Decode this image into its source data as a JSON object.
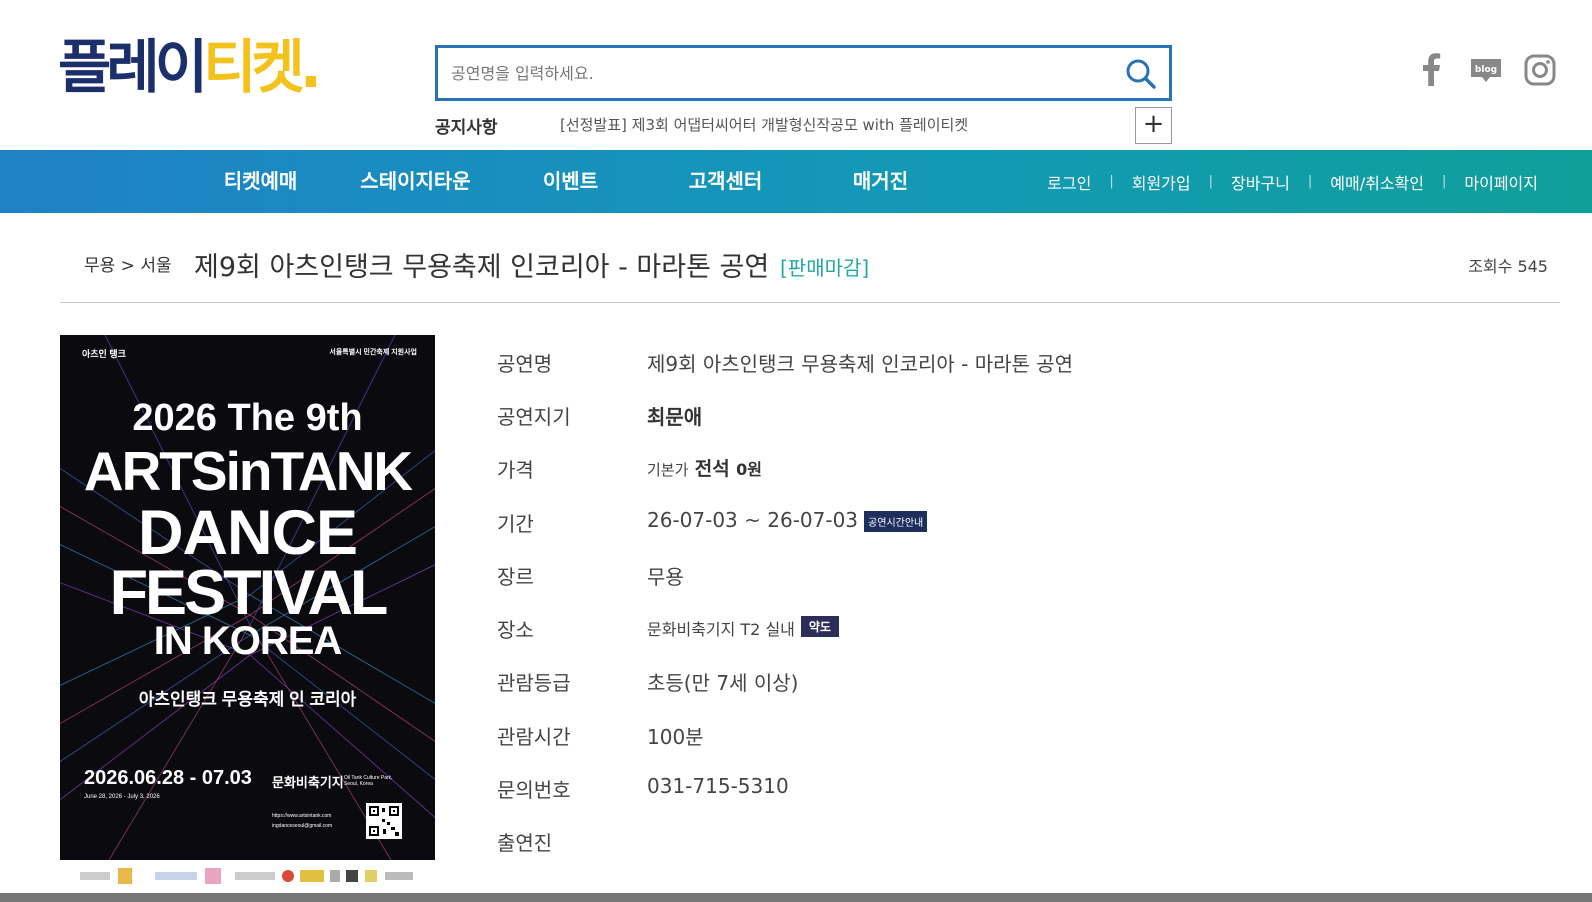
{
  "header": {
    "logo_part1": "플레이",
    "logo_part2": "티켓.",
    "search": {
      "placeholder": "공연명을 입력하세요."
    },
    "notice": {
      "label": "공지사항",
      "text": "[선정발표] 제3회 어댑터씨어터 개발형신작공모 with 플레이티켓",
      "more": "+"
    },
    "social": [
      "facebook-icon",
      "blog-icon",
      "instagram-icon"
    ],
    "blog_label": "blog"
  },
  "nav": {
    "main": [
      "티켓예매",
      "스테이지타운",
      "이벤트",
      "고객센터",
      "매거진"
    ],
    "util": [
      "로그인",
      "회원가입",
      "장바구니",
      "예매/취소확인",
      "마이페이지"
    ],
    "separator": "|"
  },
  "page": {
    "breadcrumb": "무용 > 서울",
    "title": "제9회 아츠인탱크 무용축제 인코리아 - 마라톤 공연",
    "status": "[판매마감]",
    "views": "조회수 545"
  },
  "poster": {
    "org_logo": "아츠인 탱크",
    "support": "서울특별시 민간축제 지원사업",
    "line1": "2026 The 9th",
    "line2": "ARTSinTANK",
    "line3": "DANCE",
    "line4": "FESTIVAL",
    "line5": "IN KOREA",
    "korean_title": "아츠인탱크 무용축제 인 코리아",
    "dates": "2026.06.28 - 07.03",
    "dates_en": "June 28, 2026 - July 3, 2026",
    "venue": "문화비축기지",
    "venue_en": "Oil Tank Culture Park, Seoul, Korea",
    "url": "https://www.artsintank.com",
    "email": "ingdanceseoul@gmail.com"
  },
  "details": [
    {
      "key": "공연명",
      "value": "제9회 아츠인탱크 무용축제 인코리아 - 마라톤 공연"
    },
    {
      "key": "공연지기",
      "value": "최문애"
    },
    {
      "key": "가격",
      "prefix": "기본가",
      "seat": "전석",
      "value": "0원"
    },
    {
      "key": "기간",
      "value": "26-07-03 ~ 26-07-03",
      "badge": "공연시간안내"
    },
    {
      "key": "장르",
      "value": "무용"
    },
    {
      "key": "장소",
      "value": "문화비축기지 T2 실내",
      "badge": "약도"
    },
    {
      "key": "관람등급",
      "value": "초등(만 7세 이상)"
    },
    {
      "key": "관람시간",
      "value": "100분"
    },
    {
      "key": "문의번호",
      "value": "031-715-5310"
    },
    {
      "key": "출연진",
      "value": ""
    }
  ],
  "colors": {
    "nav_start": "#1f82c6",
    "nav_end": "#0fa09a",
    "logo_navy": "#1d2f6b",
    "logo_yellow": "#f3c21c",
    "status": "#24a8a0"
  }
}
